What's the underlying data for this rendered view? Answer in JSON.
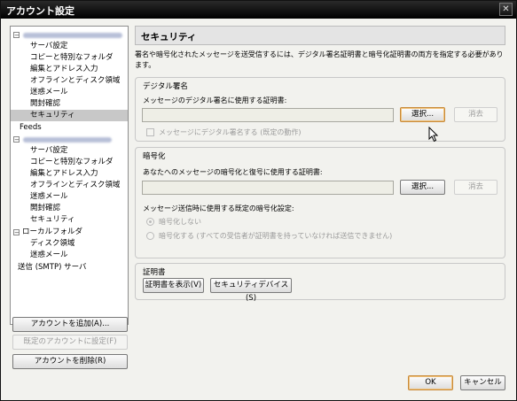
{
  "window": {
    "title": "アカウント設定",
    "close_glyph": "✕"
  },
  "tree": {
    "account1": {
      "collapse_glyph": "−",
      "items": [
        "サーバ設定",
        "コピーと特別なフォルダ",
        "編集とアドレス入力",
        "オフラインとディスク領域",
        "迷惑メール",
        "開封確認",
        "セキュリティ"
      ]
    },
    "feeds": "Feeds",
    "account2": {
      "collapse_glyph": "−",
      "items": [
        "サーバ設定",
        "コピーと特別なフォルダ",
        "編集とアドレス入力",
        "オフラインとディスク領域",
        "迷惑メール",
        "開封確認",
        "セキュリティ"
      ]
    },
    "local": {
      "collapse_glyph": "−",
      "label": "ローカルフォルダ",
      "items": [
        "ディスク領域",
        "迷惑メール"
      ]
    },
    "smtp": "送信 (SMTP) サーバ",
    "selected": "セキュリティ"
  },
  "left_buttons": {
    "add": "アカウントを追加(A)...",
    "default": "既定のアカウントに設定(F)",
    "delete": "アカウントを削除(R)"
  },
  "panel": {
    "title": "セキュリティ",
    "description": "署名や暗号化されたメッセージを送受信するには、デジタル署名証明書と暗号化証明書の両方を指定する必要があります。",
    "signing": {
      "group_label": "デジタル署名",
      "field_label": "メッセージのデジタル署名に使用する証明書:",
      "value": "",
      "select_label": "選択...",
      "clear_label": "消去",
      "checkbox_label": "メッセージにデジタル署名する (既定の動作)",
      "checkbox_checked": false
    },
    "encryption": {
      "group_label": "暗号化",
      "field_label": "あなたへのメッセージの暗号化と復号に使用する証明書:",
      "value": "",
      "select_label": "選択...",
      "clear_label": "消去",
      "default_label": "メッセージ送信時に使用する既定の暗号化設定:",
      "option_none": "暗号化しない",
      "option_required": "暗号化する (すべての受信者が証明書を持っていなければ送信できません)",
      "selected": "暗号化しない"
    },
    "certificates": {
      "group_label": "証明書",
      "view_label": "証明書を表示(V)",
      "devices_label": "セキュリティデバイス(S)"
    }
  },
  "footer": {
    "ok": "OK",
    "cancel": "キャンセル"
  },
  "colors": {
    "titlebar": "#000000",
    "selected_row": "#c8c8c8",
    "active_button_border": "#c88a3a"
  }
}
